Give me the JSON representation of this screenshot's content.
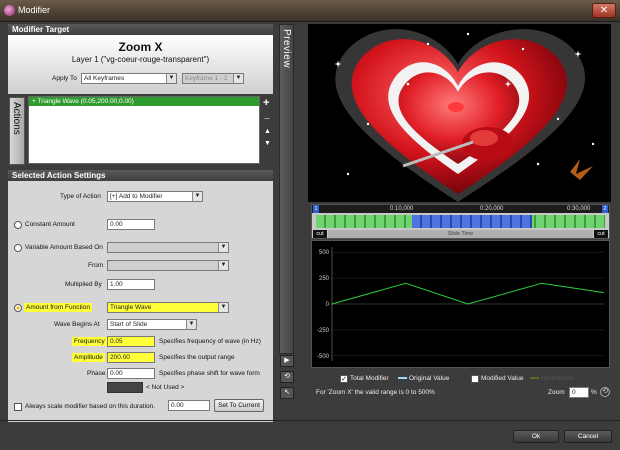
{
  "window": {
    "title": "Modifier",
    "close_label": "✕"
  },
  "modifier_target": {
    "header": "Modifier Target",
    "name": "Zoom X",
    "layer": "Layer 1 (\"vg-coeur-rouge-transparent\")",
    "apply_to_label": "Apply To",
    "apply_to_value": "All Keyframes",
    "keyframe_value": "Keyframe 1 - 2"
  },
  "actions": {
    "tab_label": "Actions",
    "items": [
      "+ Triangle Wave (0.05,200.00,0.00)"
    ]
  },
  "settings": {
    "header": "Selected Action Settings",
    "type_label": "Type of Action",
    "type_value": "[+] Add to Modifier",
    "constant_label": "Constant Amount",
    "constant_value": "0.00",
    "variable_label": "Variable Amount Based On",
    "from_label": "From",
    "multiplied_label": "Multiplied By",
    "multiplied_value": "1.00",
    "function_label": "Amount from Function",
    "function_value": "Triangle Wave",
    "wave_begins_label": "Wave Begins At",
    "wave_begins_value": "Start of Slide",
    "frequency_label": "Frequency",
    "frequency_value": "0.05",
    "frequency_desc": "Specifies frequency of wave (in Hz)",
    "amplitude_label": "Amplitude",
    "amplitude_value": "200.00",
    "amplitude_desc": "Specifies the output range",
    "phase_label": "Phase",
    "phase_value": "0.00",
    "phase_desc": "Specifies phase shift for wave form",
    "not_used": "< Not Used >",
    "always_scale_label": "Always scale modifier based on this duration.",
    "duration_value": "0.00",
    "set_current_label": "Set To Current"
  },
  "preview": {
    "tab_label": "Preview",
    "timeline": {
      "marker_start": "1",
      "marker_end": "2",
      "ticks": [
        "0:10,000",
        "0:20,000",
        "0:30,000"
      ],
      "cut_left": "cut",
      "cut_right": "cut",
      "slide_time": "Slide Time"
    },
    "graph": {
      "y_ticks": [
        "500",
        "250",
        "0",
        "-250",
        "-500"
      ],
      "chart_data": {
        "type": "line",
        "x": [
          0,
          6.5,
          12,
          18.5,
          24
        ],
        "series": [
          {
            "values": [
              0,
              200,
              0,
              200,
              110
            ],
            "color": "#2ecc40"
          }
        ],
        "ylim": [
          -550,
          550
        ]
      }
    },
    "legend": {
      "total": "Total Modifier",
      "original": "Original Value",
      "modified": "Modified Value",
      "extra": "Normalized"
    },
    "range_note": "For 'Zoom X' the valid range is 0 to 500%",
    "zoom_label": "Zoom",
    "zoom_value": "0",
    "zoom_unit": "%"
  },
  "footer": {
    "ok_label": "Ok",
    "cancel_label": "Cancel"
  },
  "colors": {
    "accent_yellow": "#ffff3a",
    "wave_green": "#2ecc40",
    "timeline_blue": "#2f5fd0"
  }
}
